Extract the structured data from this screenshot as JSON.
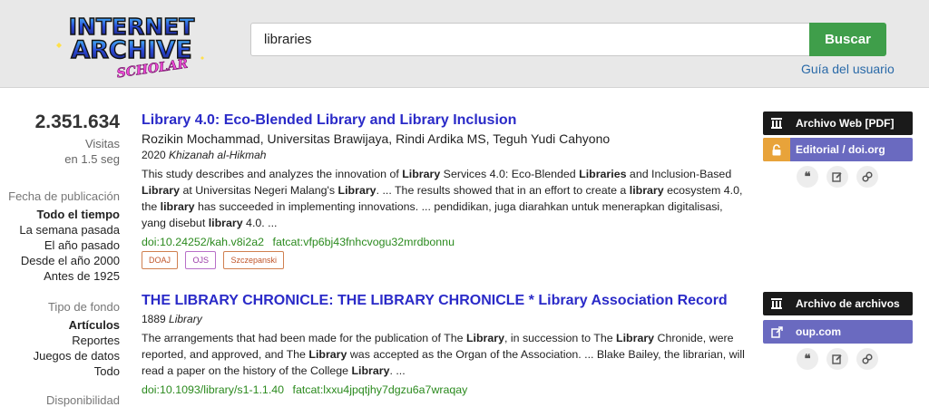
{
  "header": {
    "logo": {
      "line1": "INTERNET",
      "line2": "ARCHIVE",
      "line3": "SCHOLAR"
    },
    "search": {
      "value": "libraries",
      "button": "Buscar"
    },
    "guide_link": "Guía del usuario"
  },
  "sidebar": {
    "count": "2.351.634",
    "count_label": "Visitas",
    "time_label": "en 1.5 seg",
    "date_filter": {
      "heading": "Fecha de publicación",
      "items": [
        "Todo el tiempo",
        "La semana pasada",
        "El año pasado",
        "Desde el año 2000",
        "Antes de 1925"
      ],
      "active": "Todo el tiempo"
    },
    "type_filter": {
      "heading": "Tipo de fondo",
      "items": [
        "Artículos",
        "Reportes",
        "Juegos de datos",
        "Todo"
      ],
      "active": "Artículos"
    },
    "availability_heading": "Disponibilidad"
  },
  "results": [
    {
      "title": "Library 4.0: Eco-Blended Library and Library Inclusion",
      "authors": "Rozikin Mochammad, Universitas Brawijaya, Rindi Ardika MS, Teguh Yudi Cahyono",
      "year": "2020",
      "venue": "Khizanah al-Hikmah",
      "abstract_html": "This study describes and analyzes the innovation of <b>Library</b> Services 4.0: Eco-Blended <b>Libraries</b> and Inclusion-Based <b>Library</b> at Universitas Negeri Malang's <b>Library</b>.  ...  The results showed that in an effort to create a <b>library</b> ecosystem 4.0, the <b>library</b> has succeeded in implementing innovations.  ...  pendidikan, juga diarahkan untuk menerapkan digitalisasi, yang disebut <b>library</b> 4.0.  ...",
      "doi": "doi:10.24252/kah.v8i2a2",
      "fatcat": "fatcat:vfp6bj43fnhcvogu32mrdbonnu",
      "tags": [
        "DOAJ",
        "OJS",
        "Szczepanski"
      ],
      "actions": {
        "primary": "Archivo Web [PDF]",
        "secondary": "Editorial / doi.org"
      }
    },
    {
      "title": "THE LIBRARY CHRONICLE: THE LIBRARY CHRONICLE * Library Association Record",
      "authors": "",
      "year": "1889",
      "venue": "Library",
      "abstract_html": "The arrangements that had been made for the publication of The <b>Library</b>, in succession to The <b>Library</b> Chronide, were reported, and approved, and The <b>Library</b> was accepted as the Organ of the Association.  ...  Blake Bailey, the librarian, will read a paper on the history of the College <b>Library</b>.  ...",
      "doi": "doi:10.1093/library/s1-1.1.40",
      "fatcat": "fatcat:lxxu4jpqtjhy7dgzu6a7wraqay",
      "tags": [],
      "actions": {
        "primary": "Archivo de archivos",
        "secondary": "oup.com"
      }
    }
  ],
  "icons": {
    "archive": "archive-building-icon",
    "lock": "unlock-icon",
    "external": "external-link-icon",
    "cite": "quote-icon",
    "edit": "edit-icon",
    "link": "link-icon"
  },
  "colors": {
    "title_link": "#2a2ac8",
    "identifier": "#2b8a1e",
    "search_button": "#3f9e4a",
    "action_purple": "#6a6ac0",
    "action_dark": "#1a1a1a",
    "open_access": "#e8a33a"
  }
}
